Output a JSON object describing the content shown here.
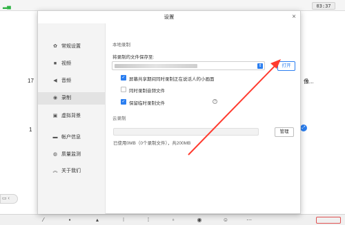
{
  "topbar": {
    "signal_icon": "wifi-icon",
    "clock": "03:37"
  },
  "background": {
    "left_number_1": "17",
    "left_number_2": "1",
    "right_text": "像...",
    "left_tab": "",
    "blue_button_icon": "expand-icon"
  },
  "dialog": {
    "title": "设置",
    "close": "×",
    "sidebar": [
      {
        "label": "常规设置",
        "icon": "gear-icon",
        "glyph": "✿"
      },
      {
        "label": "视频",
        "icon": "camera-icon",
        "glyph": "■"
      },
      {
        "label": "音频",
        "icon": "speaker-icon",
        "glyph": "◀"
      },
      {
        "label": "录制",
        "icon": "record-icon",
        "glyph": "◉"
      },
      {
        "label": "虚拟背景",
        "icon": "background-icon",
        "glyph": "▣"
      },
      {
        "label": "帐户信息",
        "icon": "account-icon",
        "glyph": "▬"
      },
      {
        "label": "质量监测",
        "icon": "monitor-icon",
        "glyph": "◍"
      },
      {
        "label": "关于我们",
        "icon": "about-icon",
        "glyph": "︽"
      }
    ],
    "active_index": 3,
    "local": {
      "section_title": "本地录制",
      "save_label": "将录制的文件保存至:",
      "open_button": "打开",
      "options": [
        {
          "label": "屏幕共享期间同时录制正在说话人的小画面",
          "checked": true
        },
        {
          "label": "同时录制音频文件",
          "checked": false
        },
        {
          "label": "保留临时录制文件",
          "checked": true
        }
      ]
    },
    "cloud": {
      "section_title": "云录制",
      "manage_button": "管理",
      "usage": "已使用0MB（0个录制文件），共200MB"
    }
  },
  "colors": {
    "accent": "#2a7ef0",
    "arrow": "#ff3b2f"
  }
}
